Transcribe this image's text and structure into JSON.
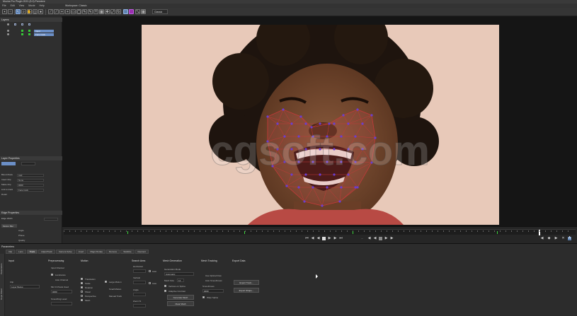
{
  "window": {
    "title": "Mocha Pro Plugin 2021 (5.0) Premiere"
  },
  "menu": [
    "File",
    "Edit",
    "View",
    "Movie",
    "Help"
  ],
  "toolbar": {
    "workspace_label": "Workspace: Classic",
    "view_select": "Classic",
    "clip_select": "Input"
  },
  "layers": {
    "header": "Layers",
    "items": [
      {
        "label": "Input"
      },
      {
        "label": "Face track"
      }
    ]
  },
  "layer_properties": {
    "header": "Layer Properties",
    "rows": [
      {
        "label": "Blend Mode",
        "value": "Add"
      },
      {
        "label": "Insert Clip",
        "value": "None"
      },
      {
        "label": "Matte Clip",
        "value": "####"
      },
      {
        "label": "Link to track",
        "value": "Face track"
      },
      {
        "label": "Detail",
        "value": ""
      }
    ]
  },
  "edge_properties": {
    "header": "Edge Properties",
    "edge_width_label": "Edge Width",
    "motion_blur_label": "Motion Blur",
    "angle_label": "Angle",
    "phase_label": "Phase",
    "quality_label": "Quality"
  },
  "viewer": {
    "watermark": "cgsoft.com"
  },
  "parameters": {
    "header": "Parameters",
    "tabs": [
      "Clip",
      "Lens",
      "Track",
      "AdjustTrack",
      "Camera Solve",
      "Insert",
      "Magic Rotate",
      "Remove",
      "Stabilize",
      "Reorient"
    ],
    "vtabs": [
      "Parameters",
      "Dope Sheet"
    ],
    "input": {
      "head": "Input",
      "clip_label": "Clip",
      "clip_value": "Layer Below"
    },
    "preprocessing": {
      "head": "Preprocessing",
      "input_channel": "Input Channel",
      "luminance": "Luminance",
      "auto_channel": "Auto Channel",
      "min_pixels": "Min % Pixels Used",
      "min_pixels_value": "####",
      "smoothing": "Smoothing Level"
    },
    "motion": {
      "head": "Motion",
      "translation": "Translation",
      "scale": "Scale",
      "rotation": "Rotation",
      "shear": "Shear",
      "perspective": "Perspective",
      "mesh": "Mesh",
      "large_motion": "Large Motion",
      "small_motion": "Small Motion",
      "manual_track": "Manual Track"
    },
    "search_area": {
      "head": "Search Area",
      "horizontal": "Horizontal",
      "auto_label": "Auto",
      "vertical": "Vertical",
      "angle": "Angle",
      "zoom": "Zoom %"
    },
    "mesh_generation": {
      "head": "Mesh Generation",
      "generation_mode": "Generation Mode",
      "mode_value": "Automatic",
      "mesh_size": "Mesh Size",
      "mesh_size_value": "12",
      "vertices_on_spline": "Vertices on Spline",
      "adaptive_contrast": "Adaptive Contrast",
      "generate_btn": "Generate Mesh",
      "clear_btn": "Clear Mesh"
    },
    "mesh_tracking": {
      "head": "Mesh Tracking",
      "use_optical_flow": "Use Optical Flow",
      "auto_smoothness": "Auto Smoothness",
      "smoothness": "Smoothness",
      "smoothness_value": "####",
      "warp_spline": "Warp Spline"
    },
    "export_data": {
      "head": "Export Data",
      "export_tracking_btn": "Export Track...",
      "export_shape_btn": "Export Shape..."
    }
  },
  "colors": {
    "accent": "#6b8fc7",
    "keyframe": "#3cd63c",
    "mesh": "#6a3fd0",
    "mesh_line": "#c23a3a"
  }
}
